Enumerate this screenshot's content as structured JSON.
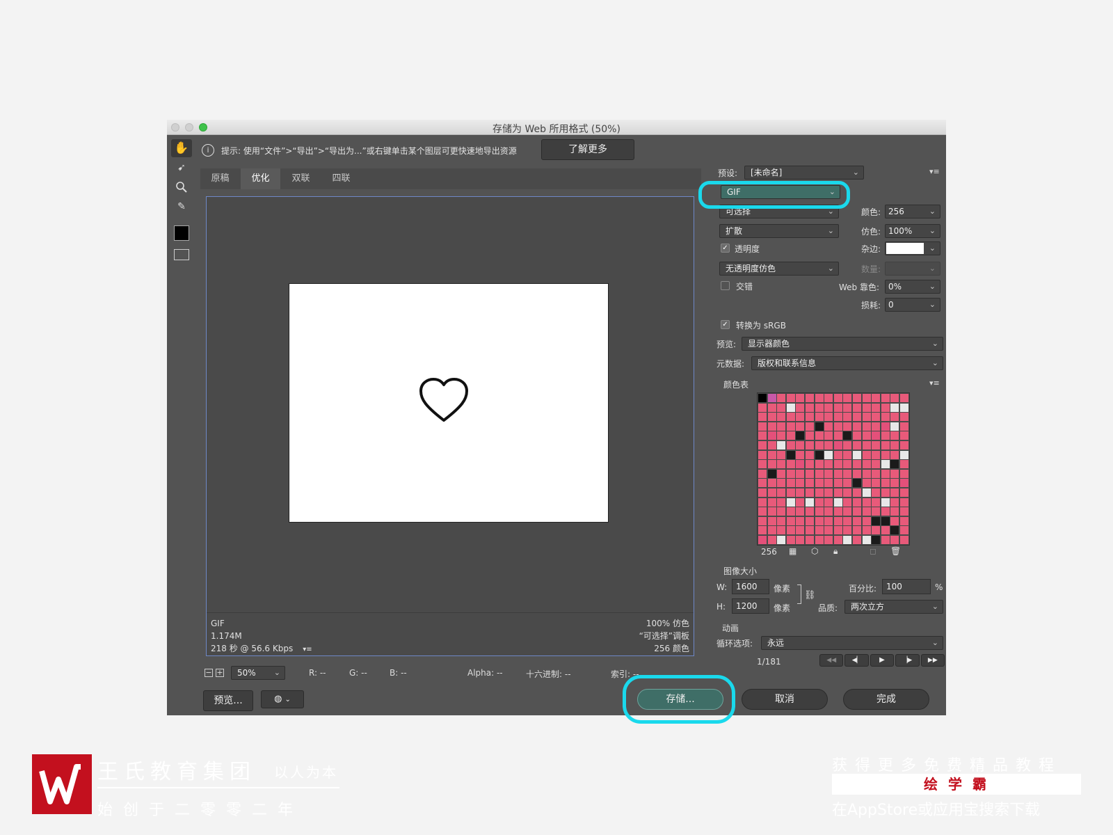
{
  "window": {
    "title": "存储为 Web 所用格式 (50%)"
  },
  "hint": {
    "text": "提示: 使用“文件”>“导出”>“导出为...”或右键单击某个图层可更快速地导出资源",
    "learn_more": "了解更多",
    "info_icon": "i"
  },
  "tools": [
    "hand-icon",
    "slice-select-icon",
    "zoom-icon",
    "eyedropper-icon",
    "color-swatch",
    "toggle-slices-icon"
  ],
  "tabs": [
    "原稿",
    "优化",
    "双联",
    "四联"
  ],
  "preview_info": {
    "format": "GIF",
    "size": "1.174M",
    "time": "218 秒 @ 56.6 Kbps",
    "dither": "100% 仿色",
    "palette": "“可选择”调板",
    "colors": "256 颜色"
  },
  "statusbar": {
    "zoom": "50%",
    "r": "R: --",
    "g": "G: --",
    "b": "B: --",
    "alpha": "Alpha: --",
    "hex": "十六进制: --",
    "index": "索引: --"
  },
  "bottom_buttons": {
    "preview": "预览...",
    "save": "存储...",
    "cancel": "取消",
    "done": "完成"
  },
  "settings": {
    "preset_label": "预设:",
    "preset_value": "[未命名]",
    "format": "GIF",
    "reduction": "可选择",
    "dither_algo": "扩散",
    "colors_label": "颜色:",
    "colors_value": "256",
    "dither_label": "仿色:",
    "dither_value": "100%",
    "transparency_label": "透明度",
    "matte_label": "杂边:",
    "trans_dither": "无透明度仿色",
    "amount_label": "数量:",
    "interlaced_label": "交错",
    "web_snap_label": "Web 靠色:",
    "web_snap_value": "0%",
    "lossy_label": "损耗:",
    "lossy_value": "0",
    "convert_srgb": "转换为 sRGB",
    "preview_label": "预览:",
    "preview_value": "显示器颜色",
    "metadata_label": "元数据:",
    "metadata_value": "版权和联系信息",
    "color_table_label": "颜色表",
    "color_count": "256",
    "image_size_label": "图像大小",
    "w_label": "W:",
    "w_value": "1600",
    "px": "像素",
    "h_label": "H:",
    "h_value": "1200",
    "percent_label": "百分比:",
    "percent_value": "100",
    "percent_unit": "%",
    "quality_label": "品质:",
    "quality_value": "两次立方",
    "animation_label": "动画",
    "loop_label": "循环选项:",
    "loop_value": "永远",
    "frame": "1/181"
  },
  "watermark": {
    "company": "王氏教育集团",
    "slogan": "以人为本",
    "founded": "始 创 于 二 零 零 二 年",
    "promo": "获 得 更 多 免 费 精 品 教 程",
    "app": "绘 学 霸",
    "store": "在AppStore或应用宝搜索下载"
  },
  "colors": {
    "accent": "#1ad9ec",
    "save_btn": "#3f6e67",
    "panel": "#535353"
  }
}
